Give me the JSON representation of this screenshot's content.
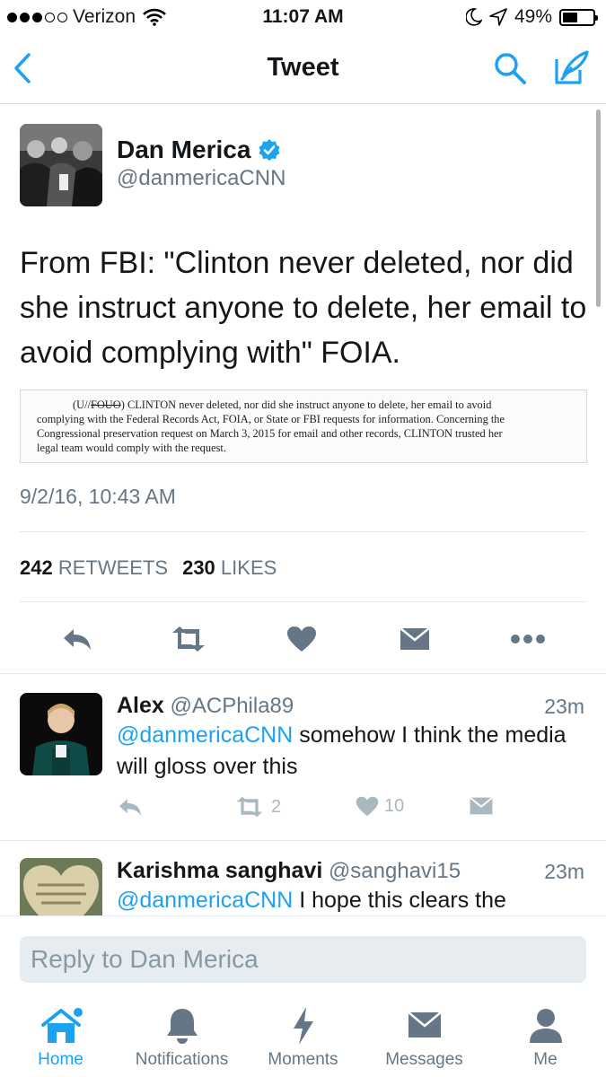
{
  "status_bar": {
    "carrier": "Verizon",
    "time": "11:07 AM",
    "battery": "49%",
    "battery_level": 0.49,
    "signal_bars_filled": 3,
    "signal_bars_total": 5
  },
  "nav": {
    "title": "Tweet",
    "accent_color": "#1da1f2"
  },
  "tweet": {
    "author_name": "Dan Merica",
    "author_handle": "@danmericaCNN",
    "verified": true,
    "text": "From FBI: \"Clinton never deleted, nor did she instruct anyone to delete, her email to avoid complying with\" FOIA.",
    "document_image": {
      "line1_prefix": "(U//",
      "line1_struck": "FOUO",
      "line1_rest": ") CLINTON never deleted, nor did she instruct anyone to delete, her email to avoid",
      "line2": "complying with the Federal Records Act, FOIA, or State or FBI requests for information.  Concerning the",
      "line3": "Congressional preservation request on March 3, 2015 for email and other records, CLINTON trusted her",
      "line4": "legal team would comply with the request."
    },
    "timestamp": "9/2/16, 10:43 AM",
    "retweet_count": "242",
    "retweet_label": "RETWEETS",
    "like_count": "230",
    "like_label": "LIKES"
  },
  "replies": [
    {
      "name": "Alex",
      "handle": "@ACPhila89",
      "time": "23m",
      "mention": "@danmericaCNN",
      "text": " somehow I think the media will gloss over this",
      "retweets": "2",
      "likes": "10"
    },
    {
      "name": "Karishma sanghavi",
      "handle": "@sanghavi15",
      "time": "23m",
      "mention": "@danmericaCNN",
      "text": " I hope this clears the"
    }
  ],
  "composer": {
    "placeholder": "Reply to Dan Merica"
  },
  "tabbar": {
    "tabs": [
      {
        "label": "Home",
        "icon": "home-icon",
        "active": true
      },
      {
        "label": "Notifications",
        "icon": "bell-icon",
        "active": false
      },
      {
        "label": "Moments",
        "icon": "lightning-icon",
        "active": false
      },
      {
        "label": "Messages",
        "icon": "envelope-icon",
        "active": false
      },
      {
        "label": "Me",
        "icon": "person-icon",
        "active": false
      }
    ]
  }
}
